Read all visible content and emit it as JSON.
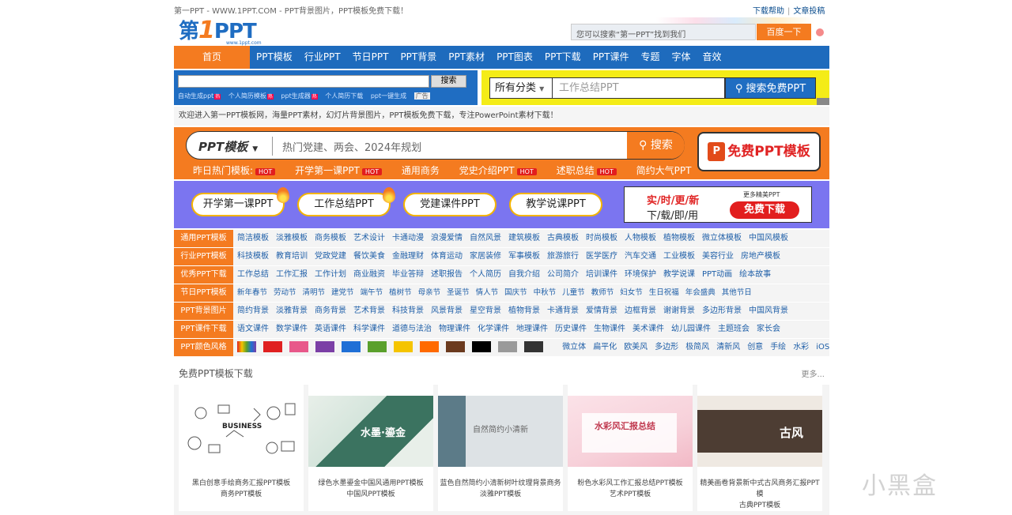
{
  "topbar": {
    "left_text": "第一PPT - WWW.1PPT.COM - PPT背景图片，PPT模板免费下载！",
    "help": "下载帮助",
    "sep": "|",
    "submit": "文章投稿"
  },
  "header": {
    "logo_text_pre": "第",
    "logo_text_one": "1",
    "logo_text_post": "PPT",
    "logo_small": "www.1ppt.com",
    "search_placeholder": "您可以搜索“第一PPT”找到我们",
    "search_button": "百度一下"
  },
  "nav": {
    "home": "首页",
    "items": [
      "PPT模板",
      "行业PPT",
      "节日PPT",
      "PPT背景",
      "PPT素材",
      "PPT图表",
      "PPT下载",
      "PPT课件",
      "专题",
      "字体",
      "音效"
    ]
  },
  "search_left": {
    "button": "搜索",
    "links": [
      {
        "label": "自动生成ppt",
        "hot": "热"
      },
      {
        "label": "个人简历模板",
        "hot": "热"
      },
      {
        "label": "ppt生成器",
        "hot": "热"
      },
      {
        "label": "个人简历下载",
        "hot": ""
      },
      {
        "label": "ppt一键生成",
        "hot": ""
      }
    ],
    "ad_label": "广告"
  },
  "search_right": {
    "category": "所有分类",
    "placeholder": "工作总结PPT",
    "button": "搜索免费PPT"
  },
  "welcome": "欢迎进入第一PPT模板网，海量PPT素材，幻灯片背景图片，PPT模板免费下载，专注PowerPoint素材下载！",
  "orange_banner": {
    "type_label": "PPT模板",
    "placeholder": "热门党建、两会、2024年规划",
    "search_button": "搜索",
    "free_button": "免费PPT模板",
    "hot_tag": "HOT",
    "hot_links": [
      {
        "label": "昨日热门模板:",
        "hot": true
      },
      {
        "label": "开学第一课PPT",
        "hot": true
      },
      {
        "label": "通用商务",
        "hot": false
      },
      {
        "label": "党史介绍PPT",
        "hot": true
      },
      {
        "label": "述职总结",
        "hot": true
      },
      {
        "label": "简约大气PPT",
        "hot": false
      }
    ]
  },
  "purple_banner": {
    "pills": [
      "开学第一课PPT",
      "工作总结PPT",
      "党建课件PPT",
      "教学说课PPT"
    ],
    "ad_title": "实/时/更/新",
    "ad_sub": "下/载/即/用",
    "ad_more": "更多精美PPT",
    "ad_button": "免费下载"
  },
  "categories": [
    {
      "label": "通用PPT模板",
      "links": [
        "简洁模板",
        "淡雅模板",
        "商务模板",
        "艺术设计",
        "卡通动漫",
        "浪漫爱情",
        "自然风景",
        "建筑模板",
        "古典模板",
        "时尚模板",
        "人物模板",
        "植物模板",
        "微立体模板",
        "中国风模板"
      ]
    },
    {
      "label": "行业PPT模板",
      "links": [
        "科技模板",
        "教育培训",
        "党政党建",
        "餐饮美食",
        "金融理财",
        "体育运动",
        "家居装修",
        "军事模板",
        "旅游旅行",
        "医学医疗",
        "汽车交通",
        "工业模板",
        "美容行业",
        "房地产模板"
      ]
    },
    {
      "label": "优秀PPT下载",
      "links": [
        "工作总结",
        "工作汇报",
        "工作计划",
        "商业融资",
        "毕业答辩",
        "述职报告",
        "个人简历",
        "自我介绍",
        "公司简介",
        "培训课件",
        "环境保护",
        "教学说课",
        "PPT动画",
        "绘本故事"
      ]
    },
    {
      "label": "节日PPT模板",
      "links": [
        "新年春节",
        "劳动节",
        "清明节",
        "建党节",
        "端午节",
        "植树节",
        "母亲节",
        "圣诞节",
        "情人节",
        "国庆节",
        "中秋节",
        "儿童节",
        "教师节",
        "妇女节",
        "生日祝福",
        "年会盛典",
        "其他节日"
      ]
    },
    {
      "label": "PPT背景图片",
      "links": [
        "简约背景",
        "淡雅背景",
        "商务背景",
        "艺术背景",
        "科技背景",
        "风景背景",
        "星空背景",
        "植物背景",
        "卡通背景",
        "爱情背景",
        "边框背景",
        "谢谢背景",
        "多边形背景",
        "中国风背景"
      ]
    },
    {
      "label": "PPT课件下载",
      "links": [
        "语文课件",
        "数学课件",
        "英语课件",
        "科学课件",
        "道德与法治",
        "物理课件",
        "化学课件",
        "地理课件",
        "历史课件",
        "生物课件",
        "美术课件",
        "幼儿园课件",
        "主题班会",
        "家长会"
      ]
    }
  ],
  "color_row": {
    "label": "PPT颜色风格",
    "colors": [
      "#e02020",
      "#e8588a",
      "#7b3fa6",
      "#1f6fd6",
      "#5aa02c",
      "#f5c400",
      "#ff6a00",
      "#6b3a1e",
      "#000000",
      "#9a9a9a",
      "#333333"
    ],
    "styles": [
      "微立体",
      "扁平化",
      "欧美风",
      "多边形",
      "极简风",
      "清新风",
      "创意",
      "手绘",
      "水彩",
      "iOS"
    ]
  },
  "templates": {
    "title": "免费PPT模板下载",
    "more": "更多...",
    "items": [
      {
        "cap1": "黑白创意手绘商务汇报PPT模板",
        "cap2": "商务PPT模板",
        "thumb_text": "BUSINESS"
      },
      {
        "cap1": "绿色水墨鎏金中国风通用PPT模板",
        "cap2": "中国风PPT模板",
        "thumb_text": "水墨·鎏金"
      },
      {
        "cap1": "蓝色自然简约小清新树叶纹理背景商务",
        "cap2": "淡雅PPT模板",
        "thumb_text": "自然简约小清新"
      },
      {
        "cap1": "粉色水彩风工作汇报总结PPT模板",
        "cap2": "艺术PPT模板",
        "thumb_text": "水彩风汇报总结"
      },
      {
        "cap1": "精美画卷背景新中式古风商务汇报PPT模",
        "cap2": "古典PPT模板",
        "thumb_text": "古风"
      }
    ]
  },
  "watermark": "小黑盒"
}
